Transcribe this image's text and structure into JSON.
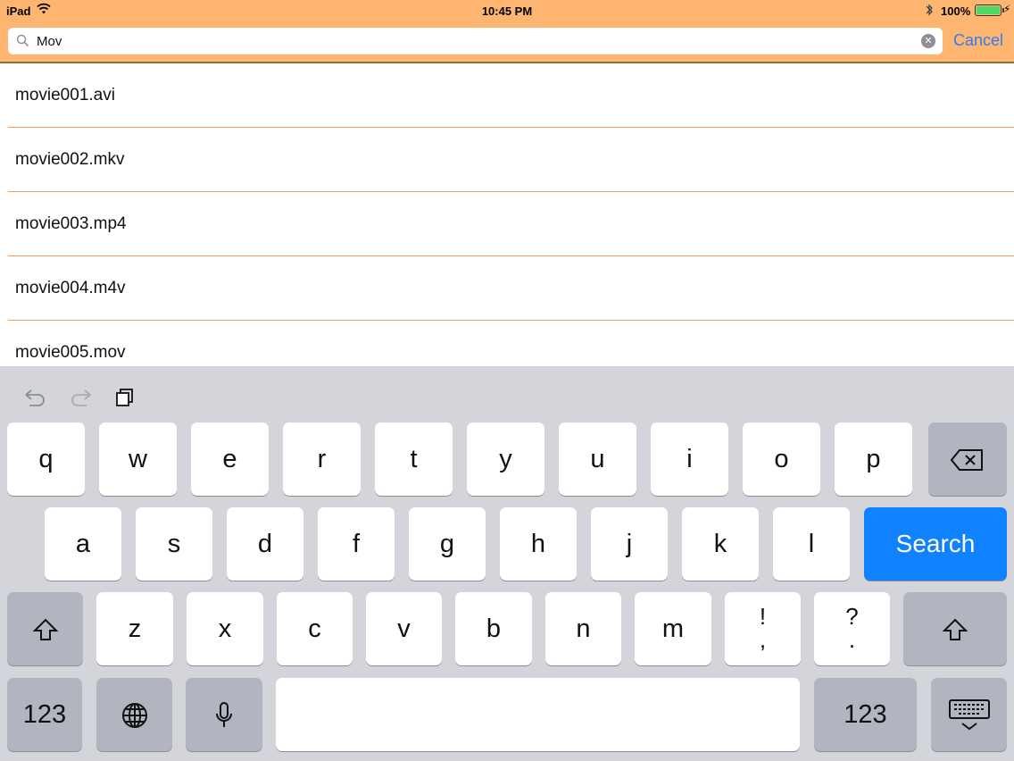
{
  "status_bar": {
    "carrier": "iPad",
    "time": "10:45 PM",
    "battery_percent": "100%"
  },
  "search": {
    "query": "Mov",
    "cancel_label": "Cancel"
  },
  "results": [
    {
      "name": "movie001.avi"
    },
    {
      "name": "movie002.mkv"
    },
    {
      "name": "movie003.mp4"
    },
    {
      "name": "movie004.m4v"
    },
    {
      "name": "movie005.mov"
    }
  ],
  "keyboard": {
    "row1": [
      "q",
      "w",
      "e",
      "r",
      "t",
      "y",
      "u",
      "i",
      "o",
      "p"
    ],
    "row2": [
      "a",
      "s",
      "d",
      "f",
      "g",
      "h",
      "j",
      "k",
      "l"
    ],
    "row3": [
      "z",
      "x",
      "c",
      "v",
      "b",
      "n",
      "m"
    ],
    "punct1": {
      "top": "!",
      "bottom": ","
    },
    "punct2": {
      "top": "?",
      "bottom": "."
    },
    "search_label": "Search",
    "numbers_label": "123",
    "icons": {
      "undo": "undo-icon",
      "redo": "redo-icon",
      "paste": "paste-icon",
      "backspace": "backspace-icon",
      "shift": "shift-icon",
      "globe": "globe-icon",
      "mic": "mic-icon",
      "dismiss": "keyboard-dismiss-icon"
    },
    "accent_color": "#1081ff"
  },
  "colors": {
    "navbar": "#fdb56f",
    "separator": "#f0a060",
    "link": "#2f7cf6"
  }
}
